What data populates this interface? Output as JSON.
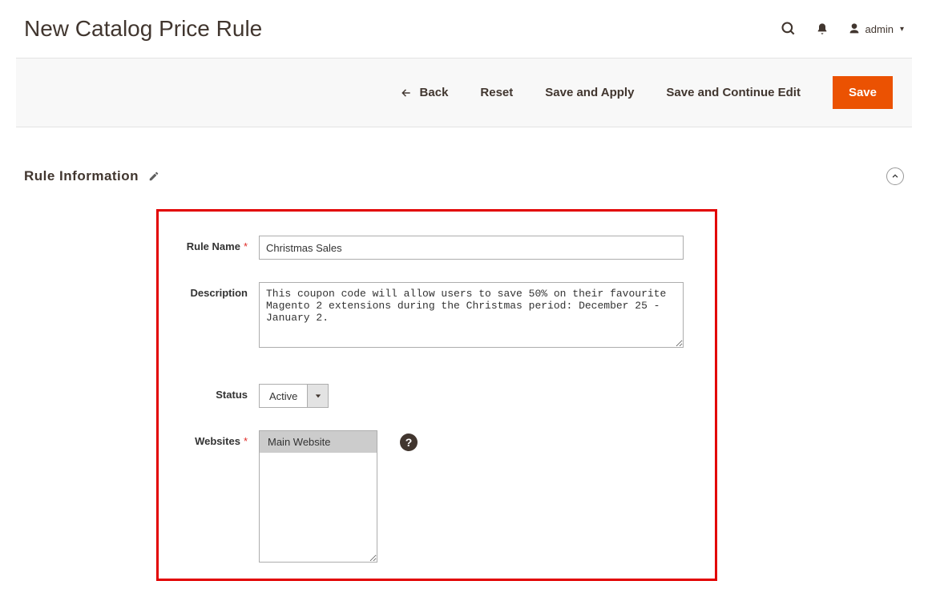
{
  "header": {
    "title": "New Catalog Price Rule",
    "user": "admin"
  },
  "actions": {
    "back": "Back",
    "reset": "Reset",
    "save_and_apply": "Save and Apply",
    "save_and_continue": "Save and Continue Edit",
    "save": "Save"
  },
  "section": {
    "title": "Rule Information"
  },
  "form": {
    "rule_name": {
      "label": "Rule Name",
      "value": "Christmas Sales"
    },
    "description": {
      "label": "Description",
      "value": "This coupon code will allow users to save 50% on their favourite Magento 2 extensions during the Christmas period: December 25 - January 2."
    },
    "status": {
      "label": "Status",
      "value": "Active"
    },
    "websites": {
      "label": "Websites",
      "selected": "Main Website"
    }
  }
}
